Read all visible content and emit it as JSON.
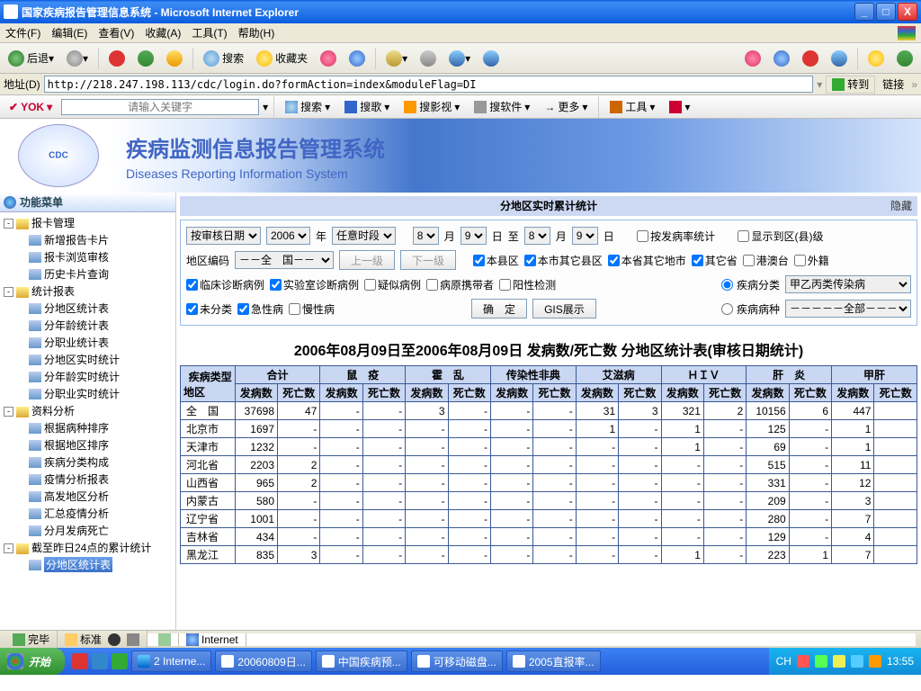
{
  "window": {
    "title": "国家疾病报告管理信息系统 - Microsoft Internet Explorer",
    "min": "_",
    "max": "□",
    "close": "X"
  },
  "menubar": {
    "items": [
      "文件(F)",
      "编辑(E)",
      "查看(V)",
      "收藏(A)",
      "工具(T)",
      "帮助(H)"
    ]
  },
  "ie_toolbar": {
    "back": "后退",
    "search": "搜索",
    "fav": "收藏夹"
  },
  "addrbar": {
    "label": "地址(D)",
    "url": "http://218.247.198.113/cdc/login.do?formAction=index&moduleFlag=DI",
    "go": "转到",
    "links": "链接"
  },
  "searchbar": {
    "yok": "YOK",
    "placeholder": "请输入关键字",
    "btns": [
      "搜索",
      "搜歌",
      "搜影视",
      "搜软件",
      "更多",
      "工具"
    ]
  },
  "banner": {
    "title_cn": "疾病监测信息报告管理系统",
    "title_en": "Diseases Reporting Information System"
  },
  "sidebar": {
    "header": "功能菜单",
    "groups": [
      {
        "label": "报卡管理",
        "exp": "-",
        "items": [
          "新增报告卡片",
          "报卡浏览审核",
          "历史卡片查询"
        ]
      },
      {
        "label": "统计报表",
        "exp": "-",
        "items": [
          "分地区统计表",
          "分年龄统计表",
          "分职业统计表",
          "分地区实时统计",
          "分年龄实时统计",
          "分职业实时统计"
        ]
      },
      {
        "label": "资料分析",
        "exp": "-",
        "items": [
          "根据病种排序",
          "根据地区排序",
          "疾病分类构成",
          "疫情分析报表",
          "高发地区分析",
          "汇总疫情分析",
          "分月发病死亡"
        ]
      },
      {
        "label": "截至昨日24点的累计统计",
        "exp": "-",
        "items": [
          "分地区统计表"
        ]
      }
    ],
    "selected": "分地区统计表"
  },
  "panel": {
    "title": "分地区实时累计统计",
    "hide": "隐藏"
  },
  "filters": {
    "date_label": "按审核日期",
    "year": "2006",
    "year_suffix": "年",
    "period": "任意时段",
    "from_m": "8",
    "m_suf": "月",
    "from_d": "9",
    "d_suf": "日",
    "to_label": "至",
    "to_m": "8",
    "to_d": "9",
    "by_rate": "按发病率统计",
    "show_county": "显示到区(县)级",
    "area_code": "地区编码",
    "area_value": "－－全　国－－",
    "btn_up": "上一级",
    "btn_down": "下一级",
    "scope": {
      "s1": "本县区",
      "s2": "本市其它县区",
      "s3": "本省其它地市",
      "s4": "其它省",
      "s5": "港澳台",
      "s6": "外籍"
    },
    "case_types": {
      "c1": "临床诊断病例",
      "c2": "实验室诊断病例",
      "c3": "疑似病例",
      "c4": "病原携带者",
      "c5": "阳性检测"
    },
    "disease_class_label": "疾病分类",
    "disease_class": "甲乙丙类传染病",
    "course": {
      "c1": "未分类",
      "c2": "急性病",
      "c3": "慢性病"
    },
    "disease_kind_label": "疾病病种",
    "disease_kind": "－－－－－全部－－－－－",
    "confirm": "确　定",
    "gis": "GIS展示"
  },
  "table": {
    "title": "2006年08月09日至2006年08月09日  发病数/死亡数  分地区统计表(审核日期统计)",
    "corner1": "疾病类型",
    "corner2": "地区",
    "col_groups": [
      "合计",
      "鼠　疫",
      "霍　乱",
      "传染性非典",
      "艾滋病",
      "ＨＩＶ",
      "肝　炎",
      "甲肝"
    ],
    "sub1": "发病数",
    "sub2": "死亡数"
  },
  "chart_data": {
    "type": "table",
    "columns": [
      "地区",
      "合计-发病数",
      "合计-死亡数",
      "鼠疫-发病数",
      "鼠疫-死亡数",
      "霍乱-发病数",
      "霍乱-死亡数",
      "传染性非典-发病数",
      "传染性非典-死亡数",
      "艾滋病-发病数",
      "艾滋病-死亡数",
      "HIV-发病数",
      "HIV-死亡数",
      "肝炎-发病数",
      "肝炎-死亡数",
      "甲肝-发病数"
    ],
    "rows": [
      {
        "region": "全　国",
        "v": [
          "37698",
          "47",
          "-",
          "-",
          "3",
          "-",
          "-",
          "-",
          "31",
          "3",
          "321",
          "2",
          "10156",
          "6",
          "447"
        ]
      },
      {
        "region": "北京市",
        "v": [
          "1697",
          "-",
          "-",
          "-",
          "-",
          "-",
          "-",
          "-",
          "1",
          "-",
          "1",
          "-",
          "125",
          "-",
          "1"
        ]
      },
      {
        "region": "天津市",
        "v": [
          "1232",
          "-",
          "-",
          "-",
          "-",
          "-",
          "-",
          "-",
          "-",
          "-",
          "1",
          "-",
          "69",
          "-",
          "1"
        ]
      },
      {
        "region": "河北省",
        "v": [
          "2203",
          "2",
          "-",
          "-",
          "-",
          "-",
          "-",
          "-",
          "-",
          "-",
          "-",
          "-",
          "515",
          "-",
          "11"
        ]
      },
      {
        "region": "山西省",
        "v": [
          "965",
          "2",
          "-",
          "-",
          "-",
          "-",
          "-",
          "-",
          "-",
          "-",
          "-",
          "-",
          "331",
          "-",
          "12"
        ]
      },
      {
        "region": "内蒙古",
        "v": [
          "580",
          "-",
          "-",
          "-",
          "-",
          "-",
          "-",
          "-",
          "-",
          "-",
          "-",
          "-",
          "209",
          "-",
          "3"
        ]
      },
      {
        "region": "辽宁省",
        "v": [
          "1001",
          "-",
          "-",
          "-",
          "-",
          "-",
          "-",
          "-",
          "-",
          "-",
          "-",
          "-",
          "280",
          "-",
          "7"
        ]
      },
      {
        "region": "吉林省",
        "v": [
          "434",
          "-",
          "-",
          "-",
          "-",
          "-",
          "-",
          "-",
          "-",
          "-",
          "-",
          "-",
          "129",
          "-",
          "4"
        ]
      },
      {
        "region": "黑龙江",
        "v": [
          "835",
          "3",
          "-",
          "-",
          "-",
          "-",
          "-",
          "-",
          "-",
          "-",
          "1",
          "-",
          "223",
          "1",
          "7"
        ]
      }
    ]
  },
  "statusbar": {
    "done": "完毕",
    "std": "标准",
    "internet": "Internet"
  },
  "taskbar": {
    "start": "开始",
    "items": [
      "2 Interne...",
      "20060809日...",
      "中国疾病预...",
      "可移动磁盘...",
      "2005直报率..."
    ],
    "lang": "CH",
    "clock": "13:55"
  }
}
